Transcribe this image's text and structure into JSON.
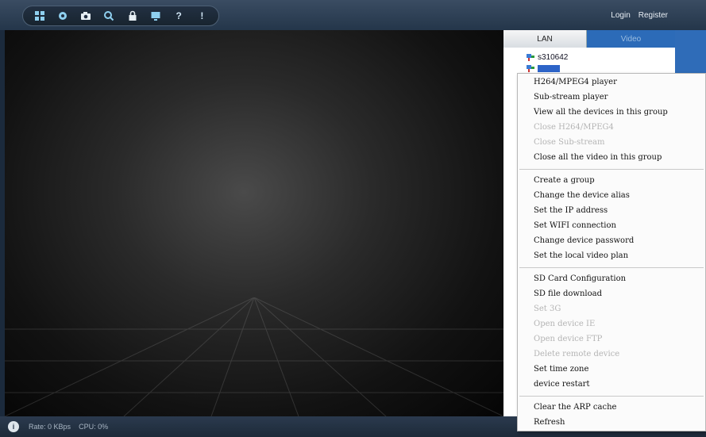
{
  "header": {
    "toolbar_icons": [
      "device-list-icon",
      "settings-gear-icon",
      "camera-snapshot-icon",
      "search-icon",
      "lock-icon",
      "monitor-icon",
      "help-icon",
      "info-icon"
    ],
    "login_label": "Login",
    "register_label": "Register"
  },
  "sidebar": {
    "tabs": [
      {
        "label": "LAN"
      },
      {
        "label": "Video"
      }
    ],
    "devices": [
      {
        "name": "s310642",
        "icon": "device-icon"
      },
      {
        "name": "",
        "icon": "device-icon",
        "selected": true
      }
    ]
  },
  "context_menu": {
    "groups": [
      [
        {
          "label": "H264/MPEG4 player",
          "enabled": true
        },
        {
          "label": "Sub-stream player",
          "enabled": true
        },
        {
          "label": "View all the devices in this group",
          "enabled": true
        },
        {
          "label": "Close H264/MPEG4",
          "enabled": false
        },
        {
          "label": "Close Sub-stream",
          "enabled": false
        },
        {
          "label": "Close all the video in this group",
          "enabled": true
        }
      ],
      [
        {
          "label": "Create a group",
          "enabled": true
        },
        {
          "label": "Change the device alias",
          "enabled": true
        },
        {
          "label": "Set the IP address",
          "enabled": true
        },
        {
          "label": "Set WIFI connection",
          "enabled": true
        },
        {
          "label": "Change device password",
          "enabled": true
        },
        {
          "label": "Set the local video plan",
          "enabled": true
        }
      ],
      [
        {
          "label": "SD Card Configuration",
          "enabled": true
        },
        {
          "label": "SD file download",
          "enabled": true
        },
        {
          "label": "Set 3G",
          "enabled": false
        },
        {
          "label": "Open device IE",
          "enabled": false
        },
        {
          "label": "Open device FTP",
          "enabled": false
        },
        {
          "label": "Delete remote device",
          "enabled": false
        },
        {
          "label": "Set time zone",
          "enabled": true
        },
        {
          "label": "device restart",
          "enabled": true
        }
      ],
      [
        {
          "label": "Clear the ARP cache",
          "enabled": true
        },
        {
          "label": "Refresh",
          "enabled": true
        }
      ]
    ]
  },
  "status": {
    "rate_label": "Rate:",
    "rate_value": "0 KBps",
    "cpu_label": "CPU:",
    "cpu_value": "0%"
  }
}
